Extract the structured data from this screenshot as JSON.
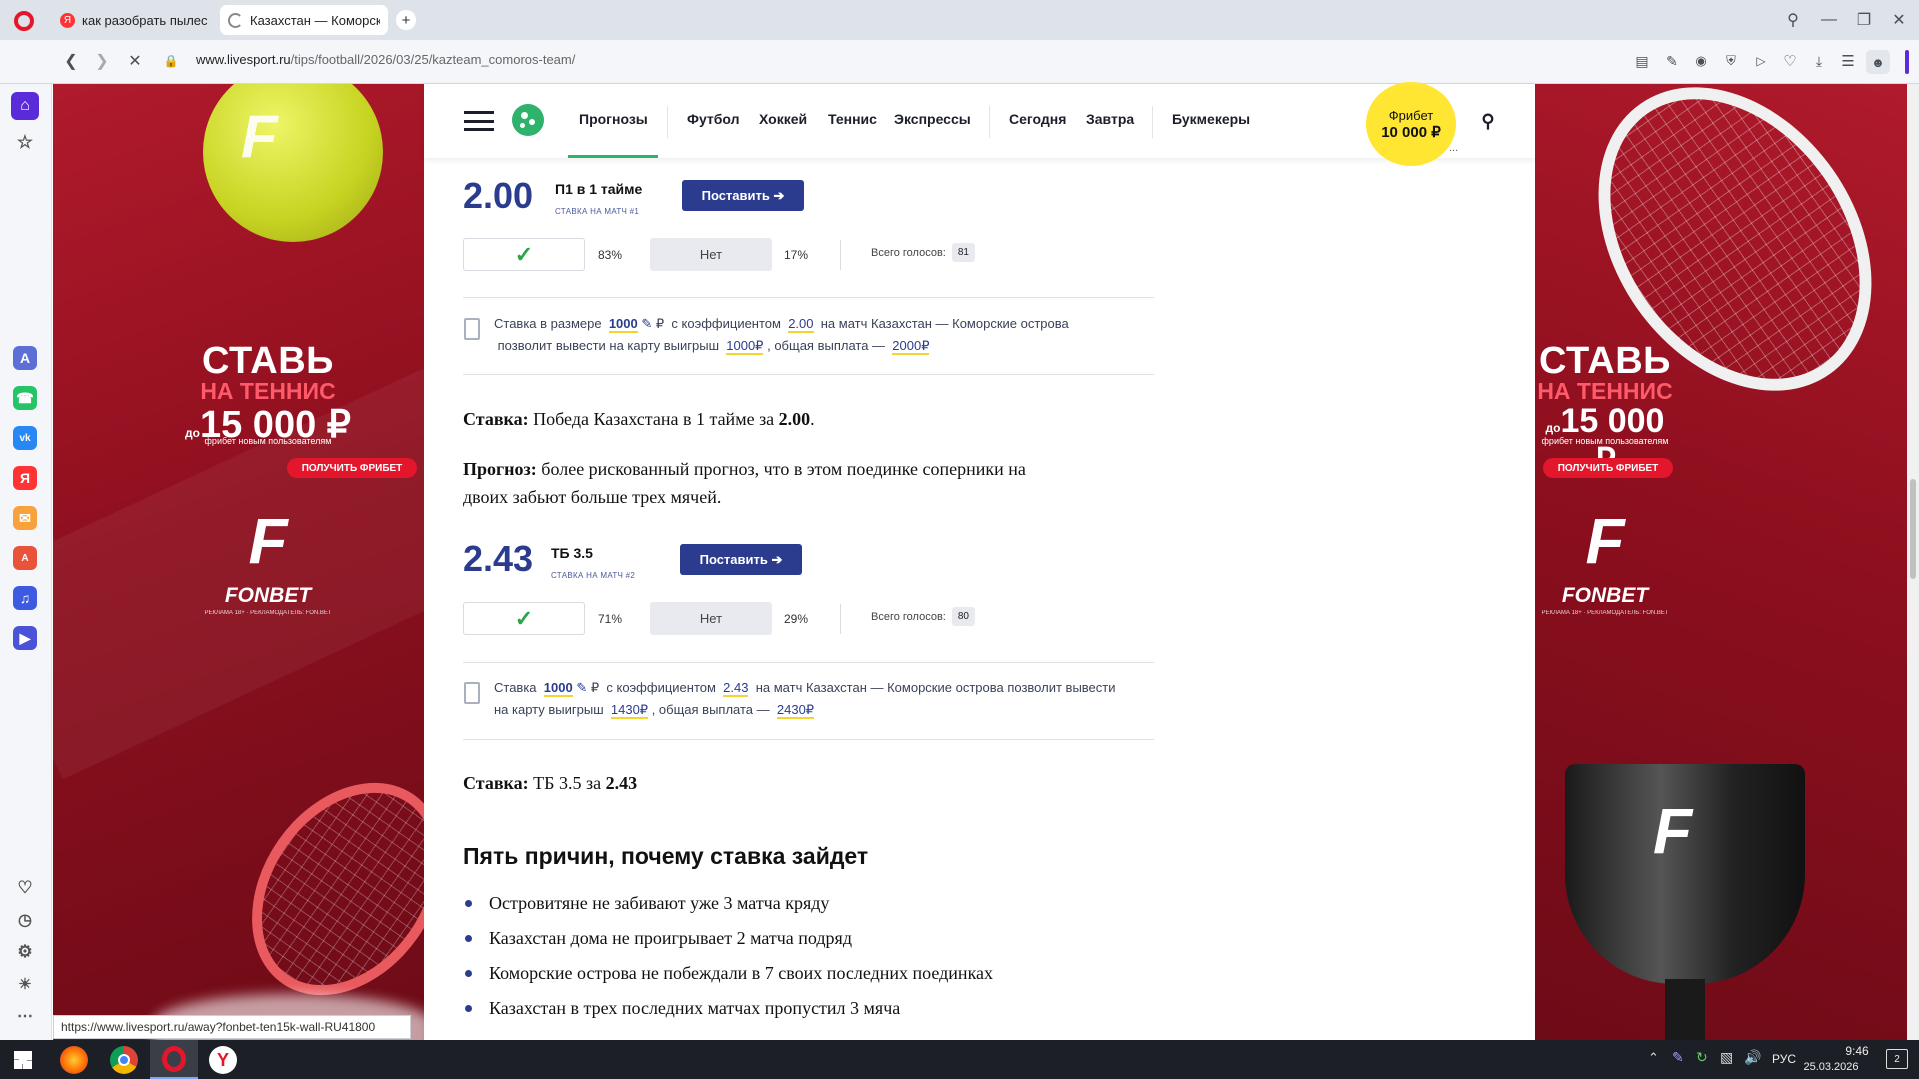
{
  "browser": {
    "tabs": [
      {
        "title": "как разобрать пылесос с",
        "active": false
      },
      {
        "title": "Казахстан — Коморские",
        "active": true
      }
    ],
    "new_tab_symbol": "+",
    "url_host": "www.livesport.ru",
    "url_path": "/tips/football/2026/03/25/kazteam_comoros-team/",
    "status_url": "https://www.livesport.ru/away?fonbet-ten15k-wall-RU41800"
  },
  "site": {
    "nav": [
      "Прогнозы",
      "Футбол",
      "Хоккей",
      "Теннис",
      "Экспрессы",
      "Сегодня",
      "Завтра",
      "Букмекеры"
    ],
    "freebet_label": "Фрибет",
    "freebet_amount": "10 000 ₽",
    "freebet_more": "..."
  },
  "ads": {
    "title": "СТАВЬ",
    "subtitle": "НА ТЕННИС",
    "amount_prefix": "до",
    "amount": "15 000 ₽",
    "note": "фрибет новым пользователям",
    "button": "ПОЛУЧИТЬ ФРИБЕТ",
    "logo_letter": "F",
    "brand": "FONBET",
    "disclaimer": "РЕКЛАМА 18+ · РЕКЛАМОДАТЕЛЬ: FON.BET"
  },
  "bets": [
    {
      "odds": "2.00",
      "type": "П1 в 1 тайме",
      "label": "СТАВКА НА МАТЧ #1",
      "button": "Поставить ➔",
      "yes_pct": "83%",
      "no_label": "Нет",
      "no_pct": "17%",
      "votes_label": "Всего голосов:",
      "votes": "81",
      "calc": {
        "p1": "Ставка в размере",
        "stake": "1000",
        "cur": "₽",
        "p2": "с коэффициентом",
        "coef": "2.00",
        "p3": "на матч Казахстан — Коморские острова",
        "p4": "позволит вывести на карту выигрыш",
        "win": "1000₽",
        "p5": ", общая выплата —",
        "total": "2000₽"
      }
    },
    {
      "odds": "2.43",
      "type": "ТБ 3.5",
      "label": "СТАВКА НА МАТЧ #2",
      "button": "Поставить ➔",
      "yes_pct": "71%",
      "no_label": "Нет",
      "no_pct": "29%",
      "votes_label": "Всего голосов:",
      "votes": "80",
      "calc": {
        "p1": "Ставка",
        "stake": "1000",
        "cur": "₽",
        "p2": "с коэффициентом",
        "coef": "2.43",
        "p3": "на матч Казахстан — Коморские острова  позволит вывести",
        "p4": "на карту выигрыш",
        "win": "1430₽",
        "p5": ", общая выплата —",
        "total": "2430₽"
      }
    }
  ],
  "text": {
    "stake1_label": "Ставка:",
    "stake1_text": "Победа Казахстана в 1 тайме за",
    "stake1_odds": "2.00",
    "stake1_end": ".",
    "forecast_label": "Прогноз:",
    "forecast_text": "более рискованный прогноз, что в этом поединке соперники на",
    "forecast_text2": "двоих забьют больше трех мячей.",
    "stake2_label": "Ставка:",
    "stake2_text": "ТБ 3.5 за",
    "stake2_odds": "2.43",
    "reasons_title": "Пять причин, почему ставка зайдет",
    "reasons": [
      "Островитяне не забивают уже 3 матча кряду",
      "Казахстан дома не проигрывает 2 матча подряд",
      "Коморские острова не побеждали в 7 своих последних поединках",
      "Казахстан в трех последних матчах пропустил 3 мяча"
    ]
  },
  "taskbar": {
    "lang": "РУС",
    "time": "9:46",
    "date": "25.03.2026",
    "notif_count": "2"
  },
  "colors": {
    "accent": "#2b3c8f",
    "nav_active_underline": "#2db36b",
    "freebet_bg": "#ffe633",
    "ad_bg": "#9a1224"
  }
}
